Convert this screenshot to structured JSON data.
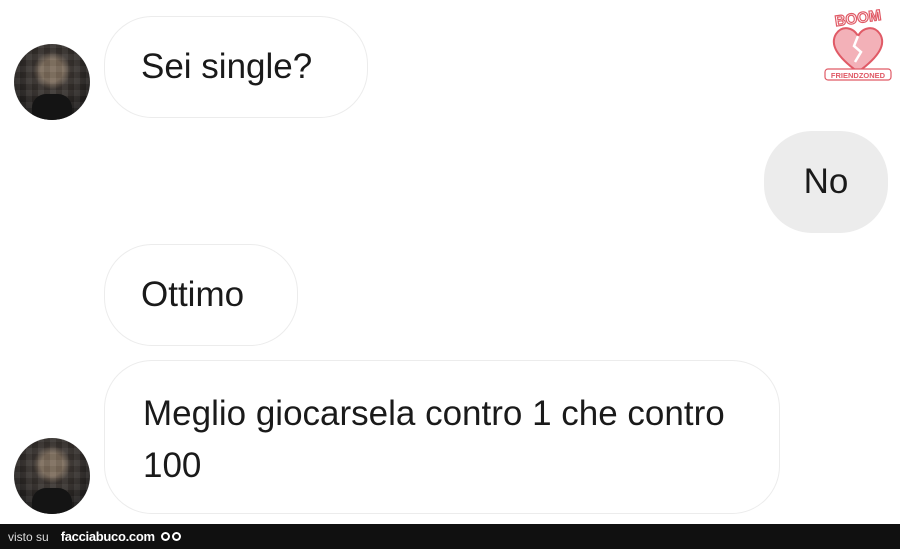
{
  "messages": [
    {
      "text": "Sei single?"
    },
    {
      "text": "No"
    },
    {
      "text": "Ottimo"
    },
    {
      "text": "Meglio giocarsela contro 1 che contro 100"
    }
  ],
  "watermark": {
    "top": "BOOM",
    "bottom": "FRIENDZONED"
  },
  "footer": {
    "prefix": "visto su",
    "site": "facciabuco.com"
  },
  "colors": {
    "incoming_border": "#ececec",
    "outgoing_bubble": "#ececec",
    "logo": "#e05a66",
    "footer": "#101010"
  }
}
